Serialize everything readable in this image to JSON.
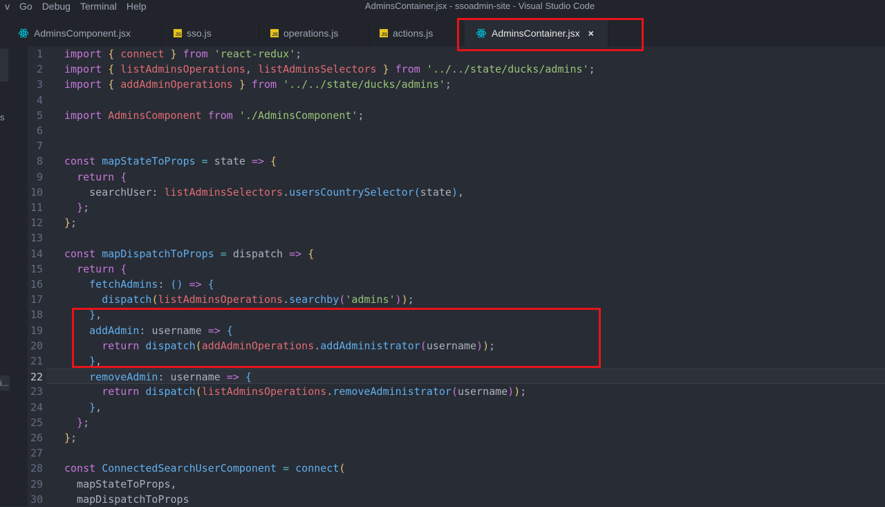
{
  "titlebar": {
    "menu": [
      "v",
      "Go",
      "Debug",
      "Terminal",
      "Help"
    ],
    "title": "AdminsContainer.jsx - ssoadmin-site - Visual Studio Code"
  },
  "tabs": [
    {
      "label": "AdminsComponent.jsx",
      "icon": "react-icon",
      "active": false
    },
    {
      "label": "sso.js",
      "icon": "js-icon",
      "active": false
    },
    {
      "label": "operations.js",
      "icon": "js-icon",
      "active": false
    },
    {
      "label": "actions.js",
      "icon": "js-icon",
      "active": false
    },
    {
      "label": "AdminsContainer.jsx",
      "icon": "react-icon",
      "active": true,
      "close": "×"
    }
  ],
  "js_badge": "JS",
  "activity": {
    "s": "s",
    "i": "i..."
  },
  "editor": {
    "current_line": 22,
    "lines": [
      [
        [
          "k",
          "import "
        ],
        [
          "b1",
          "{"
        ],
        [
          "t",
          " "
        ],
        [
          "r",
          "connect"
        ],
        [
          "t",
          " "
        ],
        [
          "b1",
          "}"
        ],
        [
          "k",
          " from "
        ],
        [
          "s",
          "'react-redux'"
        ],
        [
          "p",
          ";"
        ]
      ],
      [
        [
          "k",
          "import "
        ],
        [
          "b1",
          "{"
        ],
        [
          "t",
          " "
        ],
        [
          "r",
          "listAdminsOperations"
        ],
        [
          "p",
          ", "
        ],
        [
          "r",
          "listAdminsSelectors"
        ],
        [
          "t",
          " "
        ],
        [
          "b1",
          "}"
        ],
        [
          "k",
          " from "
        ],
        [
          "s",
          "'../../state/ducks/admins'"
        ],
        [
          "p",
          ";"
        ]
      ],
      [
        [
          "k",
          "import "
        ],
        [
          "b1",
          "{"
        ],
        [
          "t",
          " "
        ],
        [
          "r",
          "addAdminOperations"
        ],
        [
          "t",
          " "
        ],
        [
          "b1",
          "}"
        ],
        [
          "k",
          " from "
        ],
        [
          "s",
          "'../../state/ducks/admins'"
        ],
        [
          "p",
          ";"
        ]
      ],
      [],
      [
        [
          "k",
          "import "
        ],
        [
          "r",
          "AdminsComponent"
        ],
        [
          "k",
          " from "
        ],
        [
          "s",
          "'./AdminsComponent'"
        ],
        [
          "p",
          ";"
        ]
      ],
      [],
      [],
      [
        [
          "k",
          "const "
        ],
        [
          "f",
          "mapStateToProps"
        ],
        [
          "o",
          " = "
        ],
        [
          "t",
          "state "
        ],
        [
          "k",
          "=>"
        ],
        [
          "t",
          " "
        ],
        [
          "b1",
          "{"
        ]
      ],
      [
        [
          "t",
          "  "
        ],
        [
          "k",
          "return "
        ],
        [
          "b2",
          "{"
        ]
      ],
      [
        [
          "t",
          "    searchUser: "
        ],
        [
          "r",
          "listAdminsSelectors"
        ],
        [
          "p",
          "."
        ],
        [
          "f",
          "usersCountrySelector"
        ],
        [
          "b3",
          "("
        ],
        [
          "t",
          "state"
        ],
        [
          "b3",
          ")"
        ],
        [
          "p",
          ","
        ]
      ],
      [
        [
          "t",
          "  "
        ],
        [
          "b2",
          "}"
        ],
        [
          "p",
          ";"
        ]
      ],
      [
        [
          "b1",
          "}"
        ],
        [
          "p",
          ";"
        ]
      ],
      [],
      [
        [
          "k",
          "const "
        ],
        [
          "f",
          "mapDispatchToProps"
        ],
        [
          "o",
          " = "
        ],
        [
          "t",
          "dispatch "
        ],
        [
          "k",
          "=>"
        ],
        [
          "t",
          " "
        ],
        [
          "b1",
          "{"
        ]
      ],
      [
        [
          "t",
          "  "
        ],
        [
          "k",
          "return "
        ],
        [
          "b2",
          "{"
        ]
      ],
      [
        [
          "t",
          "    "
        ],
        [
          "f",
          "fetchAdmins"
        ],
        [
          "p",
          ": "
        ],
        [
          "b3",
          "()"
        ],
        [
          "k",
          " => "
        ],
        [
          "b3",
          "{"
        ]
      ],
      [
        [
          "t",
          "      "
        ],
        [
          "f",
          "dispatch"
        ],
        [
          "b1",
          "("
        ],
        [
          "r",
          "listAdminsOperations"
        ],
        [
          "p",
          "."
        ],
        [
          "f",
          "searchby"
        ],
        [
          "b2",
          "("
        ],
        [
          "s",
          "'admins'"
        ],
        [
          "b2",
          ")"
        ],
        [
          "b1",
          ")"
        ],
        [
          "p",
          ";"
        ]
      ],
      [
        [
          "t",
          "    "
        ],
        [
          "b3",
          "}"
        ],
        [
          "p",
          ","
        ]
      ],
      [
        [
          "t",
          "    "
        ],
        [
          "f",
          "addAdmin"
        ],
        [
          "p",
          ": "
        ],
        [
          "t",
          "username "
        ],
        [
          "k",
          "=>"
        ],
        [
          "t",
          " "
        ],
        [
          "b3",
          "{"
        ]
      ],
      [
        [
          "t",
          "      "
        ],
        [
          "k",
          "return "
        ],
        [
          "f",
          "dispatch"
        ],
        [
          "b1",
          "("
        ],
        [
          "r",
          "addAdminOperations"
        ],
        [
          "p",
          "."
        ],
        [
          "f",
          "addAdministrator"
        ],
        [
          "b2",
          "("
        ],
        [
          "t",
          "username"
        ],
        [
          "b2",
          ")"
        ],
        [
          "b1",
          ")"
        ],
        [
          "p",
          ";"
        ]
      ],
      [
        [
          "t",
          "    "
        ],
        [
          "b3",
          "}"
        ],
        [
          "p",
          ","
        ]
      ],
      [
        [
          "t",
          "    "
        ],
        [
          "f",
          "removeAdmin"
        ],
        [
          "p",
          ": "
        ],
        [
          "t",
          "username "
        ],
        [
          "k",
          "=>"
        ],
        [
          "t",
          " "
        ],
        [
          "b3",
          "{"
        ]
      ],
      [
        [
          "t",
          "      "
        ],
        [
          "k",
          "return "
        ],
        [
          "f",
          "dispatch"
        ],
        [
          "b1",
          "("
        ],
        [
          "r",
          "listAdminsOperations"
        ],
        [
          "p",
          "."
        ],
        [
          "f",
          "removeAdministrator"
        ],
        [
          "b2",
          "("
        ],
        [
          "t",
          "username"
        ],
        [
          "b2",
          ")"
        ],
        [
          "b1",
          ")"
        ],
        [
          "p",
          ";"
        ]
      ],
      [
        [
          "t",
          "    "
        ],
        [
          "b3",
          "}"
        ],
        [
          "p",
          ","
        ]
      ],
      [
        [
          "t",
          "  "
        ],
        [
          "b2",
          "}"
        ],
        [
          "p",
          ";"
        ]
      ],
      [
        [
          "b1",
          "}"
        ],
        [
          "p",
          ";"
        ]
      ],
      [],
      [
        [
          "k",
          "const "
        ],
        [
          "f",
          "ConnectedSearchUserComponent"
        ],
        [
          "o",
          " = "
        ],
        [
          "f",
          "connect"
        ],
        [
          "b1",
          "("
        ]
      ],
      [
        [
          "t",
          "  mapStateToProps,"
        ]
      ],
      [
        [
          "t",
          "  mapDispatchToProps"
        ]
      ]
    ]
  },
  "colors": {
    "highlight_box": "#e8131b",
    "background": "#282c34",
    "react": "#00bcd4"
  }
}
